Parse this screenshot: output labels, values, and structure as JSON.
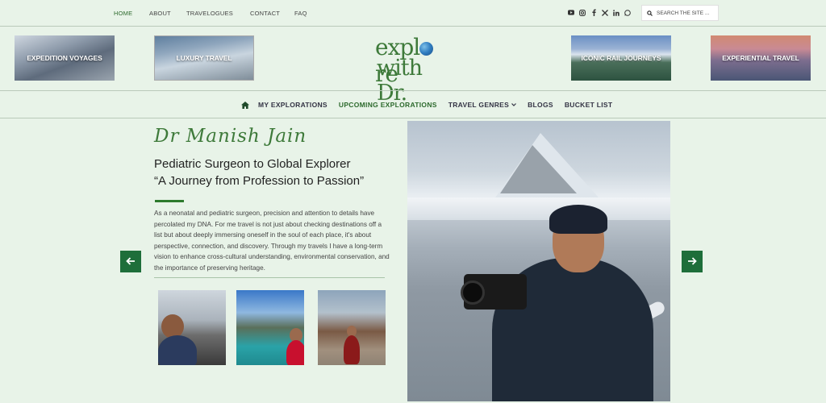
{
  "topnav": {
    "items": [
      "HOME",
      "ABOUT",
      "TRAVELOGUES",
      "CONTACT",
      "FAQ"
    ]
  },
  "social": {
    "icons": [
      "youtube-icon",
      "instagram-icon",
      "facebook-icon",
      "x-icon",
      "linkedin-icon",
      "whatsapp-icon"
    ]
  },
  "search": {
    "placeholder": "SEARCH THE SITE ..."
  },
  "promo_tiles": [
    {
      "label": "EXPEDITION VOYAGES"
    },
    {
      "label": "LUXURY TRAVEL"
    },
    {
      "label": "ICONIC RAIL JOURNEYS"
    },
    {
      "label": "EXPERIENTIAL TRAVEL"
    }
  ],
  "logo": {
    "line1_a": "expl",
    "line1_b": "re",
    "line2": "with Dr."
  },
  "mainnav": {
    "items": [
      "MY EXPLORATIONS",
      "UPCOMING EXPLORATIONS",
      "TRAVEL GENRES",
      "BLOGS",
      "BUCKET LIST"
    ]
  },
  "hero": {
    "name": "Dr Manish Jain",
    "headline_line1": "Pediatric Surgeon to Global Explorer",
    "headline_line2": "“A Journey from Profession to Passion”",
    "paragraph": "As a neonatal and pediatric surgeon, precision and attention to details have percolated my DNA. For me travel is not just about checking destinations off a list but about deeply immersing oneself in the soul of each place, it's about perspective, connection, and discovery. Through my travels I have a long-term vision to enhance cross-cultural understanding, environmental conservation, and the importance of preserving heritage."
  },
  "colors": {
    "accent_green": "#2d6a2d",
    "page_bg": "#e8f3e8",
    "arrow_bg": "#1e6e3a"
  }
}
